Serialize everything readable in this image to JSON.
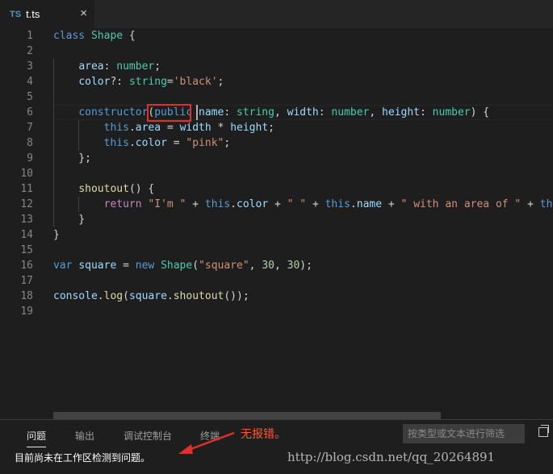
{
  "tab": {
    "badge": "TS",
    "filename": "t.ts",
    "close": "×"
  },
  "code": [
    {
      "n": "1",
      "tokens": [
        [
          "k",
          "class"
        ],
        [
          "",
          " "
        ],
        [
          "t",
          "Shape"
        ],
        [
          "",
          " {"
        ]
      ]
    },
    {
      "n": "2",
      "tokens": []
    },
    {
      "n": "3",
      "tokens": [
        [
          "",
          "    "
        ],
        [
          "p",
          "area"
        ],
        [
          "",
          ": "
        ],
        [
          "t",
          "number"
        ],
        [
          "",
          ";"
        ]
      ]
    },
    {
      "n": "4",
      "tokens": [
        [
          "",
          "    "
        ],
        [
          "p",
          "color"
        ],
        [
          "",
          "?: "
        ],
        [
          "t",
          "string"
        ],
        [
          "",
          "="
        ],
        [
          "s",
          "'black'"
        ],
        [
          "",
          ";"
        ]
      ]
    },
    {
      "n": "5",
      "tokens": []
    },
    {
      "n": "6",
      "tokens": [
        [
          "",
          "    "
        ],
        [
          "k",
          "constructor"
        ],
        [
          "",
          "("
        ],
        [
          "k",
          "public"
        ],
        [
          "",
          " "
        ],
        [
          "p",
          "name"
        ],
        [
          "",
          ": "
        ],
        [
          "t",
          "string"
        ],
        [
          "",
          ", "
        ],
        [
          "p",
          "width"
        ],
        [
          "",
          ": "
        ],
        [
          "t",
          "number"
        ],
        [
          "",
          ", "
        ],
        [
          "p",
          "height"
        ],
        [
          "",
          ": "
        ],
        [
          "t",
          "number"
        ],
        [
          "",
          ") {"
        ]
      ]
    },
    {
      "n": "7",
      "tokens": [
        [
          "",
          "        "
        ],
        [
          "k",
          "this"
        ],
        [
          "",
          "."
        ],
        [
          "p",
          "area"
        ],
        [
          "",
          " = "
        ],
        [
          "p",
          "width"
        ],
        [
          "",
          " * "
        ],
        [
          "p",
          "height"
        ],
        [
          "",
          ";"
        ]
      ]
    },
    {
      "n": "8",
      "tokens": [
        [
          "",
          "        "
        ],
        [
          "k",
          "this"
        ],
        [
          "",
          "."
        ],
        [
          "p",
          "color"
        ],
        [
          "",
          " = "
        ],
        [
          "s",
          "\"pink\""
        ],
        [
          "",
          ";"
        ]
      ]
    },
    {
      "n": "9",
      "tokens": [
        [
          "",
          "    };"
        ]
      ]
    },
    {
      "n": "10",
      "tokens": []
    },
    {
      "n": "11",
      "tokens": [
        [
          "",
          "    "
        ],
        [
          "f",
          "shoutout"
        ],
        [
          "",
          "() {"
        ]
      ]
    },
    {
      "n": "12",
      "tokens": [
        [
          "",
          "        "
        ],
        [
          "c",
          "return"
        ],
        [
          "",
          " "
        ],
        [
          "s",
          "\"I'm \""
        ],
        [
          "",
          " + "
        ],
        [
          "k",
          "this"
        ],
        [
          "",
          "."
        ],
        [
          "p",
          "color"
        ],
        [
          "",
          " + "
        ],
        [
          "s",
          "\" \""
        ],
        [
          "",
          " + "
        ],
        [
          "k",
          "this"
        ],
        [
          "",
          "."
        ],
        [
          "p",
          "name"
        ],
        [
          "",
          " + "
        ],
        [
          "s",
          "\" with an area of \""
        ],
        [
          "",
          " + "
        ],
        [
          "k",
          "this"
        ]
      ]
    },
    {
      "n": "13",
      "tokens": [
        [
          "",
          "    }"
        ]
      ]
    },
    {
      "n": "14",
      "tokens": [
        [
          "",
          "}"
        ]
      ]
    },
    {
      "n": "15",
      "tokens": []
    },
    {
      "n": "16",
      "tokens": [
        [
          "k",
          "var"
        ],
        [
          "",
          " "
        ],
        [
          "p",
          "square"
        ],
        [
          "",
          " = "
        ],
        [
          "k",
          "new"
        ],
        [
          "",
          " "
        ],
        [
          "t",
          "Shape"
        ],
        [
          "",
          "("
        ],
        [
          "s",
          "\"square\""
        ],
        [
          "",
          ", "
        ],
        [
          "n",
          "30"
        ],
        [
          "",
          ", "
        ],
        [
          "n",
          "30"
        ],
        [
          "",
          ");"
        ]
      ]
    },
    {
      "n": "17",
      "tokens": []
    },
    {
      "n": "18",
      "tokens": [
        [
          "p",
          "console"
        ],
        [
          "",
          "."
        ],
        [
          "f",
          "log"
        ],
        [
          "",
          "("
        ],
        [
          "p",
          "square"
        ],
        [
          "",
          "."
        ],
        [
          "f",
          "shoutout"
        ],
        [
          "",
          "());"
        ]
      ]
    },
    {
      "n": "19",
      "tokens": []
    }
  ],
  "panel": {
    "tabs": [
      "问题",
      "输出",
      "调试控制台",
      "终端"
    ],
    "annotation": "无报错。",
    "filter_placeholder": "按类型或文本进行筛选",
    "message": "目前尚未在工作区检测到问题。"
  },
  "watermark": "http://blog.csdn.net/qq_20264891",
  "colors": {
    "highlight_box": "#e0302a",
    "annotation": "#ff5533"
  }
}
